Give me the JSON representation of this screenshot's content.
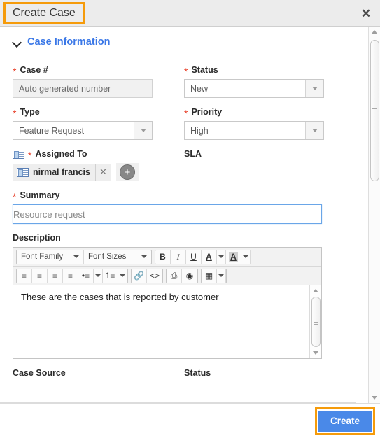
{
  "header": {
    "title": "Create Case",
    "close_icon": "close-icon"
  },
  "section": {
    "title": "Case Information",
    "chevron_icon": "chevron-down-icon"
  },
  "fields": {
    "case_number": {
      "label": "Case #",
      "required": true,
      "placeholder": "Auto generated number",
      "value": ""
    },
    "status": {
      "label": "Status",
      "required": true,
      "value": "New"
    },
    "type": {
      "label": "Type",
      "required": true,
      "value": "Feature Request"
    },
    "priority": {
      "label": "Priority",
      "required": true,
      "value": "High"
    },
    "assigned_to": {
      "label": "Assigned To",
      "required": true,
      "icon": "contact-card-icon",
      "chip_name": "nirmal francis",
      "remove_label": "✕",
      "add_label": "+"
    },
    "sla": {
      "label": "SLA"
    },
    "summary": {
      "label": "Summary",
      "required": true,
      "placeholder": "Resource request",
      "value": ""
    },
    "description": {
      "label": "Description"
    },
    "case_source": {
      "label": "Case Source"
    },
    "status_bottom": {
      "label": "Status"
    }
  },
  "editor": {
    "font_family": "Font Family",
    "font_sizes": "Font Sizes",
    "bold": "B",
    "italic": "I",
    "underline": "U",
    "text_color": "A",
    "highlight_color": "A",
    "align_left": "≡",
    "align_center": "≡",
    "align_right": "≡",
    "align_justify": "≡",
    "bullet_list": "•≡",
    "numbered_list": "1≡",
    "link": "🔗",
    "code": "<>",
    "print": "⎙",
    "preview": "◉",
    "table": "▦",
    "content": "These are the cases that is reported by customer"
  },
  "footer": {
    "create_label": "Create"
  },
  "colors": {
    "accent_blue": "#3b78e7",
    "button_blue": "#4a89e8",
    "highlight_orange": "#f59b0b",
    "required_red": "#e8402a"
  }
}
